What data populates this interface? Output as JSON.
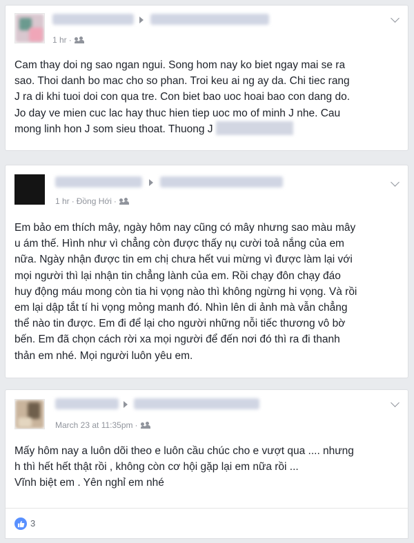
{
  "posts": [
    {
      "time": "1 hr",
      "location": "",
      "text": "Cam thay doi ng sao ngan ngui. Song hom nay ko biet ngay mai se ra\nsao. Thoi danh bo mac cho so phan. Troi keu ai ng ay da. Chi tiec rang\nJ ra di khi tuoi doi con qua tre. Con biet bao uoc hoai bao con dang do.\nJo day ve mien cuc lac hay thuc hien tiep uoc mo of minh J nhe. Cau\nmong linh hon J som sieu thoat. Thuong J"
    },
    {
      "time": "1 hr",
      "location": "Đồng Hới",
      "text": "Em bảo em thích mây, ngày hôm nay cũng có mây nhưng sao màu mây\nu ám thế. Hình như vì chẳng còn được thấy nụ cười toả nắng của em\nnữa. Ngày nhận được tin em chị chưa hết vui mừng vì được làm lại với\nmọi người thì lại nhận tin chẳng lành của em. Rồi chạy đôn chạy đáo\nhuy động máu mong còn tia hi vọng nào thì không ngừng hi vọng. Và rồi\nem lại dập tắt tí hi vọng mỏng manh đó. Nhìn lên di ảnh mà vẫn chẳng\nthể nào tin được. Em đi để lại cho người những nỗi tiếc thương vô bờ\nbến. Em đã chọn cách rời xa mọi người để đến nơi đó thì ra đi thanh\nthản em nhé. Mọi người luôn yêu em."
    },
    {
      "time": "March 23 at 11:35pm",
      "location": "",
      "text": "Mấy hôm nay a luôn dõi theo e luôn cầu chúc cho e vượt qua .... nhưng\nh thì hết hết thật rồi , không còn cơ hội gặp lại em nữa rồi ...\nVĩnh biệt em . Yên nghỉ em nhé"
    }
  ],
  "reactions": {
    "count": "3",
    "icon": "like-icon"
  },
  "colors": {
    "page_bg": "#e9ebee",
    "card_bg": "#ffffff",
    "meta": "#90949c",
    "like": "#5890ff"
  }
}
